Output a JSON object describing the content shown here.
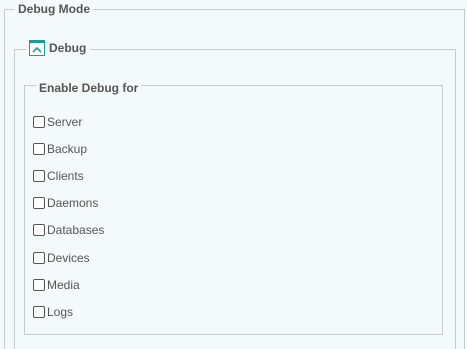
{
  "debug_mode": {
    "title": "Debug Mode",
    "panel": {
      "title": "Debug",
      "collapse_icon": "chevron-up-icon",
      "group": {
        "title": "Enable Debug for",
        "options": [
          {
            "label": "Server",
            "checked": false
          },
          {
            "label": "Backup",
            "checked": false
          },
          {
            "label": "Clients",
            "checked": false
          },
          {
            "label": "Daemons",
            "checked": false
          },
          {
            "label": "Databases",
            "checked": false
          },
          {
            "label": "Devices",
            "checked": false
          },
          {
            "label": "Media",
            "checked": false
          },
          {
            "label": "Logs",
            "checked": false
          }
        ]
      }
    }
  },
  "colors": {
    "accent": "#1d9a9a",
    "background": "#f4fafa",
    "border": "#c8cccc"
  }
}
